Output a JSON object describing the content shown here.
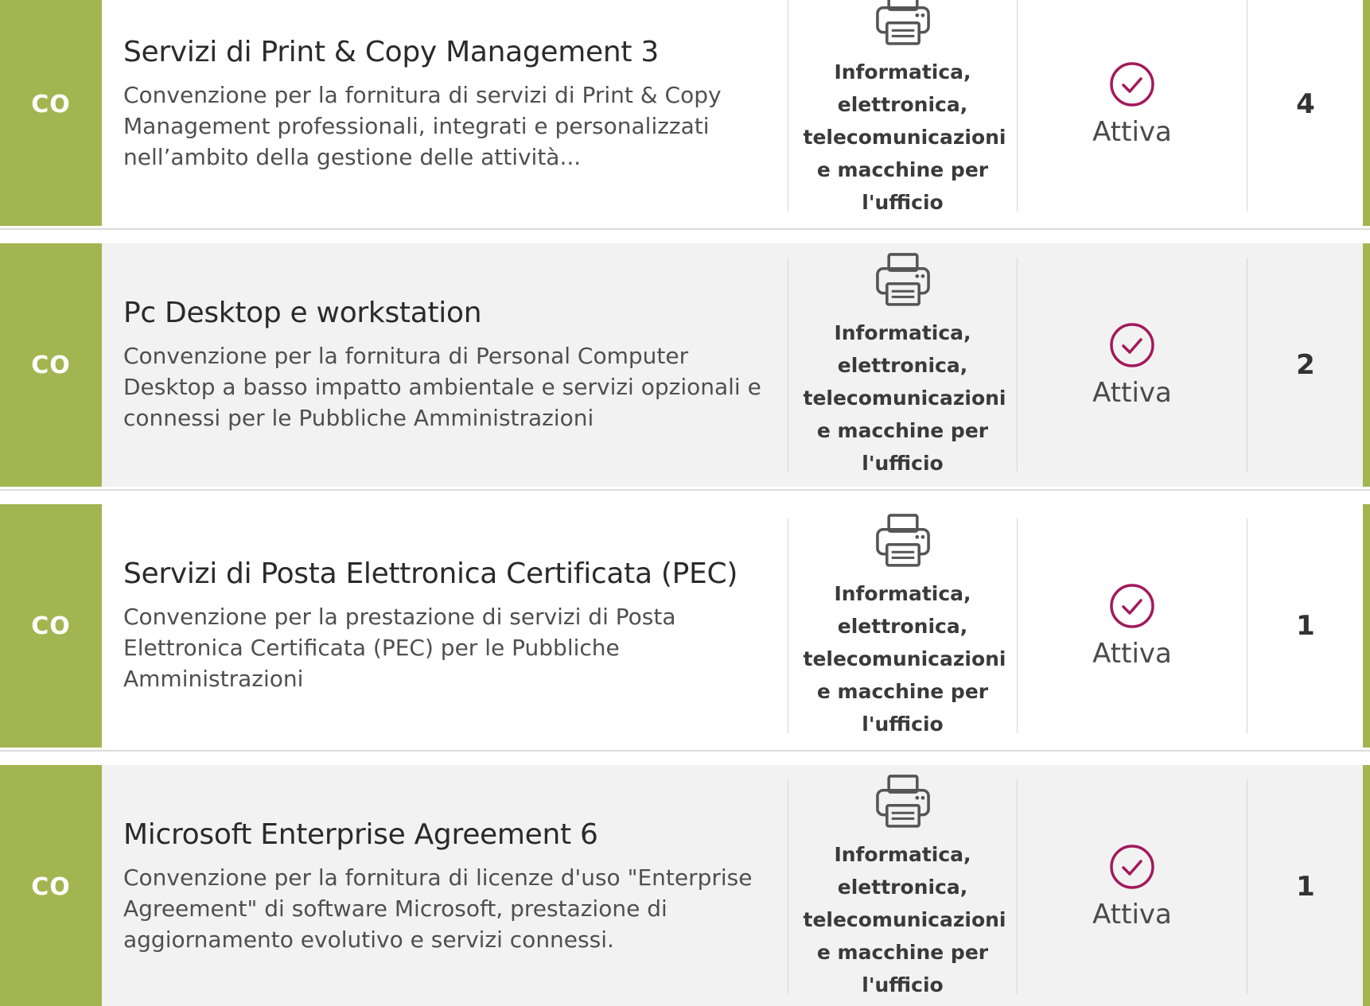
{
  "colors": {
    "accent": "#a3b550",
    "status_check": "#a3195b",
    "row_alt": "#f2f2f2"
  },
  "rows": [
    {
      "code": "CO",
      "title": "Servizi di Print & Copy Management 3",
      "description": "Convenzione per la fornitura di servizi di Print & Copy Management professionali, integrati e personalizzati nell’ambito della gestione delle attività...",
      "category_icon": "printer-icon",
      "category": "Informatica, elettronica, telecomunicazioni e macchine per l'ufficio",
      "status_icon": "check-circle-icon",
      "status": "Attiva",
      "count": "4"
    },
    {
      "code": "CO",
      "title": "Pc Desktop e workstation",
      "description": "Convenzione per la fornitura di Personal Computer Desktop a basso impatto ambientale e servizi opzionali e connessi per le Pubbliche Amministrazioni",
      "category_icon": "printer-icon",
      "category": "Informatica, elettronica, telecomunicazioni e macchine per l'ufficio",
      "status_icon": "check-circle-icon",
      "status": "Attiva",
      "count": "2"
    },
    {
      "code": "CO",
      "title": "Servizi di Posta Elettronica Certificata (PEC)",
      "description": "Convenzione per la prestazione di servizi di Posta Elettronica Certificata (PEC) per le Pubbliche Amministrazioni",
      "category_icon": "printer-icon",
      "category": "Informatica, elettronica, telecomunicazioni e macchine per l'ufficio",
      "status_icon": "check-circle-icon",
      "status": "Attiva",
      "count": "1"
    },
    {
      "code": "CO",
      "title": "Microsoft Enterprise Agreement 6",
      "description": "Convenzione per la fornitura di licenze d'uso \"Enterprise Agreement\" di software Microsoft, prestazione di aggiornamento evolutivo e servizi connessi.",
      "category_icon": "printer-icon",
      "category": "Informatica, elettronica, telecomunicazioni e macchine per l'ufficio",
      "status_icon": "check-circle-icon",
      "status": "Attiva",
      "count": "1"
    }
  ]
}
